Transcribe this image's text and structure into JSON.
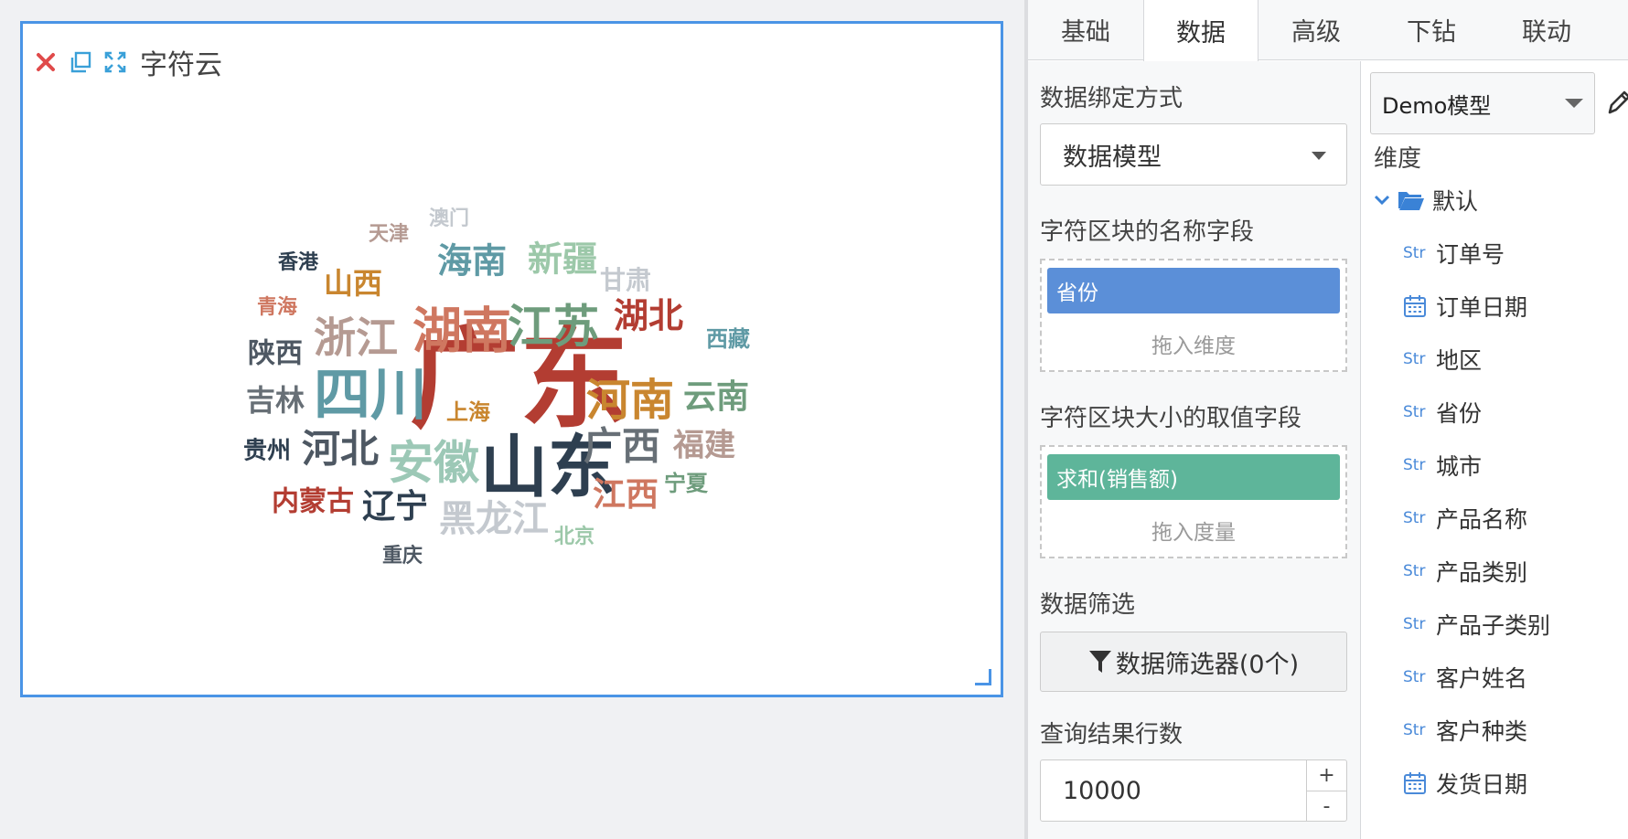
{
  "widget": {
    "title": "字符云",
    "icons": [
      "close-icon",
      "copy-icon",
      "fullscreen-icon"
    ],
    "border_color": "#4a94e6",
    "words": [
      {
        "text": "广东",
        "color": "#b33d32"
      },
      {
        "text": "山东",
        "color": "#2e3f50"
      },
      {
        "text": "四川",
        "color": "#5f9aa5"
      },
      {
        "text": "湖南",
        "color": "#cf7760"
      },
      {
        "text": "江苏",
        "color": "#6e9c7c"
      },
      {
        "text": "河南",
        "color": "#c9862f"
      },
      {
        "text": "浙江",
        "color": "#b59a92"
      },
      {
        "text": "安徽",
        "color": "#9cc8b6"
      },
      {
        "text": "河北",
        "color": "#4e5863"
      },
      {
        "text": "广西",
        "color": "#676f76"
      },
      {
        "text": "湖北",
        "color": "#b33d32"
      },
      {
        "text": "海南",
        "color": "#5f9aa5"
      },
      {
        "text": "新疆",
        "color": "#9cc8a9"
      },
      {
        "text": "云南",
        "color": "#6e9c7c"
      },
      {
        "text": "福建",
        "color": "#b59a92"
      },
      {
        "text": "江西",
        "color": "#cf7760"
      },
      {
        "text": "辽宁",
        "color": "#2e3f50"
      },
      {
        "text": "黑龙江",
        "color": "#c4c9cf"
      },
      {
        "text": "陕西",
        "color": "#4e5863"
      },
      {
        "text": "吉林",
        "color": "#676f76"
      },
      {
        "text": "山西",
        "color": "#c9862f"
      },
      {
        "text": "甘肃",
        "color": "#c4c9cf"
      },
      {
        "text": "内蒙古",
        "color": "#b33d32"
      },
      {
        "text": "贵州",
        "color": "#2e3f50"
      },
      {
        "text": "西藏",
        "color": "#5f9aa5"
      },
      {
        "text": "上海",
        "color": "#c9862f"
      },
      {
        "text": "宁夏",
        "color": "#6e9c7c"
      },
      {
        "text": "青海",
        "color": "#cf7760"
      },
      {
        "text": "天津",
        "color": "#b59a92"
      },
      {
        "text": "香港",
        "color": "#2e3f50"
      },
      {
        "text": "澳门",
        "color": "#c4c9cf"
      },
      {
        "text": "北京",
        "color": "#9cc8a9"
      },
      {
        "text": "重庆",
        "color": "#4e5863"
      }
    ]
  },
  "tabs": [
    {
      "label": "基础",
      "active": false
    },
    {
      "label": "数据",
      "active": true
    },
    {
      "label": "高级",
      "active": false
    },
    {
      "label": "下钻",
      "active": false
    },
    {
      "label": "联动",
      "active": false
    }
  ],
  "data_panel": {
    "binding_label": "数据绑定方式",
    "binding_value": "数据模型",
    "name_field_label": "字符区块的名称字段",
    "name_field_pill": "省份",
    "name_field_hint": "拖入维度",
    "size_field_label": "字符区块大小的取值字段",
    "size_field_pill": "求和(销售额)",
    "size_field_hint": "拖入度量",
    "filter_label": "数据筛选",
    "filter_button": "数据筛选器(0个)",
    "rows_label": "查询结果行数",
    "rows_value": "10000",
    "step_up": "+",
    "step_down": "-"
  },
  "model_panel": {
    "model_value": "Demo模型",
    "dimension_label": "维度",
    "folder_label": "默认",
    "type_str_label": "Str",
    "fields": [
      {
        "label": "订单号",
        "type": "str"
      },
      {
        "label": "订单日期",
        "type": "date"
      },
      {
        "label": "地区",
        "type": "str"
      },
      {
        "label": "省份",
        "type": "str"
      },
      {
        "label": "城市",
        "type": "str"
      },
      {
        "label": "产品名称",
        "type": "str"
      },
      {
        "label": "产品类别",
        "type": "str"
      },
      {
        "label": "产品子类别",
        "type": "str"
      },
      {
        "label": "客户姓名",
        "type": "str"
      },
      {
        "label": "客户种类",
        "type": "str"
      },
      {
        "label": "发货日期",
        "type": "date"
      }
    ]
  }
}
